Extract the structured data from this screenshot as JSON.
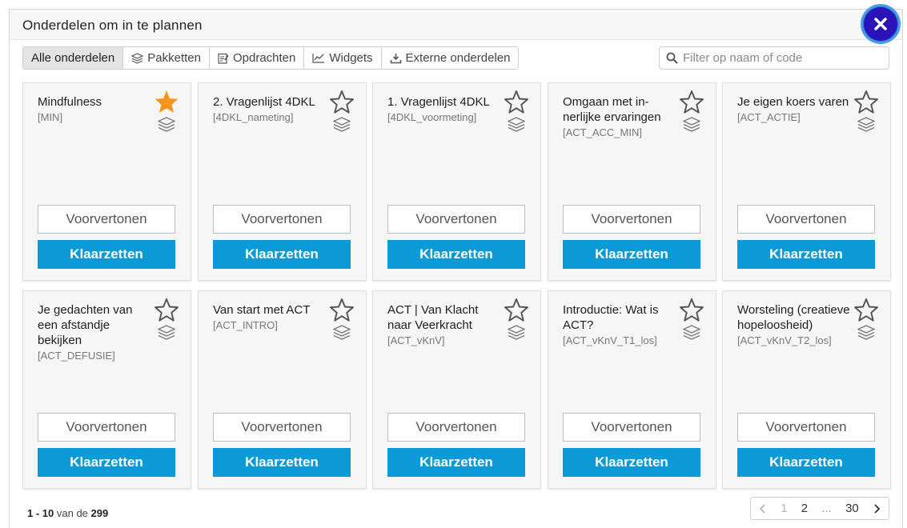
{
  "modal": {
    "title": "Onderdelen om in te plannen"
  },
  "tabs": [
    {
      "label": "Alle onderdelen",
      "icon": "none",
      "active": true
    },
    {
      "label": "Pakketten",
      "icon": "layers-icon"
    },
    {
      "label": "Opdrachten",
      "icon": "edit-icon"
    },
    {
      "label": "Widgets",
      "icon": "chart-icon"
    },
    {
      "label": "Externe onderdelen",
      "icon": "import-icon"
    }
  ],
  "search": {
    "placeholder": "Filter op naam of code",
    "value": ""
  },
  "cards": [
    {
      "title": "Mindfulness",
      "code": "[MIN]",
      "starred": true
    },
    {
      "title": "2. Vragenlijst 4DKL",
      "code": "[4DKL_nameting]",
      "starred": false
    },
    {
      "title": "1. Vragenlijst 4DKL",
      "code": "[4DKL_voormeting]",
      "starred": false
    },
    {
      "title": "Omgaan met in­nerlijke ervaringen",
      "code": "[ACT_ACC_MIN]",
      "starred": false
    },
    {
      "title": "Je eigen koers varen",
      "code": "[ACT_ACTIE]",
      "starred": false
    },
    {
      "title": "Je gedachten van een af­standje bekijken",
      "code": "[ACT_DEFUSIE]",
      "starred": false
    },
    {
      "title": "Van start met ACT",
      "code": "[ACT_INTRO]",
      "starred": false
    },
    {
      "title": "ACT | Van Klacht naar Veerkracht",
      "code": "[ACT_vKnV]",
      "starred": false
    },
    {
      "title": "Introductie: Wat is ACT?",
      "code": "[ACT_vKnV_T1_los]",
      "starred": false
    },
    {
      "title": "Worsteling (crea­tieve hopeloosheid)",
      "code": "[ACT_vKnV_T2_los]",
      "starred": false
    }
  ],
  "buttons": {
    "preview_label": "Voorvertonen",
    "ready_label": "Klaarzetten"
  },
  "footer": {
    "range_start": "1",
    "range_sep": " - ",
    "range_end": "10",
    "of_label": " van de ",
    "total": "299"
  },
  "pager": {
    "pages": [
      "1",
      "2",
      "...",
      "30"
    ],
    "current": "1"
  },
  "colors": {
    "accent": "#0a9ad8",
    "star_active": "#f7941d",
    "close_bg": "#2a13b8"
  }
}
